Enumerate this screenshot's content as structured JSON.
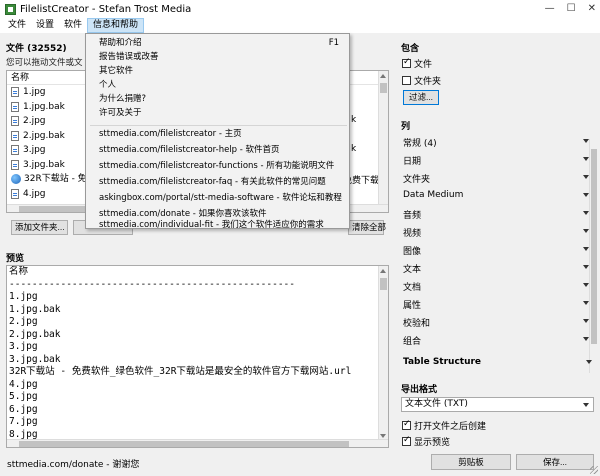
{
  "window": {
    "title": "FilelistCreator - Stefan Trost Media",
    "controls": {
      "minimize": "—",
      "maximize": "☐",
      "close": "✕"
    }
  },
  "menubar": [
    "文件",
    "设置",
    "软件",
    "信息和帮助"
  ],
  "left": {
    "files_label": "文件 (32552)",
    "hint": "您可以拖动文件或文",
    "list_header": "名称",
    "list_items": [
      "1.jpg",
      "1.jpg.bak",
      "2.jpg",
      "2.jpg.bak",
      "3.jpg",
      "3.jpg.bak",
      "32R下载站 - 免",
      "4.jpg"
    ],
    "list_right_items": [
      "k",
      "k",
      "k",
      "免费下载站"
    ],
    "buttons": {
      "add_files": "添加文件夹...",
      "clear_all": "清除全部"
    },
    "preview_label": "预览",
    "preview_lines": [
      "名称",
      "--------------------------------------------------",
      "1.jpg",
      "1.jpg.bak",
      "2.jpg",
      "2.jpg.bak",
      "3.jpg",
      "3.jpg.bak",
      "32R下载站 - 免费软件_绿色软件_32R下载站是最安全的软件官方下载网站.url",
      "4.jpg",
      "5.jpg",
      "6.jpg",
      "7.jpg",
      "8.jpg"
    ]
  },
  "right": {
    "include_label": "包含",
    "include_files": "文件",
    "include_folders": "文件夹",
    "filter_button": "过滤...",
    "columns_label": "列",
    "column_groups": [
      {
        "label": "常规",
        "count": "(4)"
      },
      {
        "label": "日期"
      },
      {
        "label": "文件夹"
      },
      {
        "label": "Data Medium"
      },
      {
        "label": "音频"
      },
      {
        "label": "视频"
      },
      {
        "label": "图像"
      },
      {
        "label": "文本"
      },
      {
        "label": "文档"
      },
      {
        "label": "属性"
      },
      {
        "label": "校验和"
      },
      {
        "label": "组合"
      }
    ],
    "table_structure": "Table Structure",
    "export_label": "导出格式",
    "export_value": "文本文件 (TXT)",
    "open_after": "打开文件之后创建",
    "show_preview": "显示预览",
    "clipboard_button": "剪贴板",
    "save_button": "保存..."
  },
  "dropdown": {
    "items": [
      {
        "label": "帮助和介绍",
        "shortcut": "F1"
      },
      {
        "label": "报告错误或改善"
      },
      {
        "label": "其它软件"
      },
      {
        "label": "个人"
      },
      {
        "label": "为什么捐赠?"
      },
      {
        "label": "许可及关于"
      }
    ],
    "links": [
      "sttmedia.com/filelistcreator - 主页",
      "sttmedia.com/filelistcreator-help - 软件首页",
      "sttmedia.com/filelistcreator-functions - 所有功能说明文件",
      "sttmedia.com/filelistcreator-faq - 有关此软件的常见问题",
      "askingbox.com/portal/stt-media-software - 软件论坛和教程",
      "sttmedia.com/donate - 如果你喜欢该软件",
      "sttmedia.com/individual-fit - 我们这个软件适应你的需求"
    ]
  },
  "status": {
    "text": "sttmedia.com/donate - 谢谢您"
  }
}
